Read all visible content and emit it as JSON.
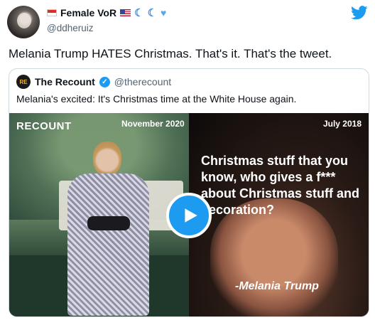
{
  "author": {
    "display_name": "Female VoR",
    "handle": "@ddheruiz",
    "badges": [
      "indonesia-flag-icon",
      "us-flag-icon",
      "crescent-moon-icon",
      "crescent-moon-icon",
      "blue-heart-icon"
    ]
  },
  "tweet": {
    "text": "Melania Trump HATES Christmas. That's it. That's the tweet."
  },
  "quoted": {
    "display_name": "The Recount",
    "handle": "@therecount",
    "text": "Melania's excited: It's Christmas time at the White House again.",
    "media": {
      "logo_text": "RECOUNT",
      "date_left": "November 2020",
      "date_right": "July 2018",
      "overlay_text": "Christmas stuff that you know, who gives a f*** about Christmas stuff and decoration?",
      "attribution": "-Melania Trump"
    }
  },
  "colors": {
    "twitter_blue": "#1d9bf0",
    "secondary_text": "#536471",
    "border": "#cfd9de"
  }
}
